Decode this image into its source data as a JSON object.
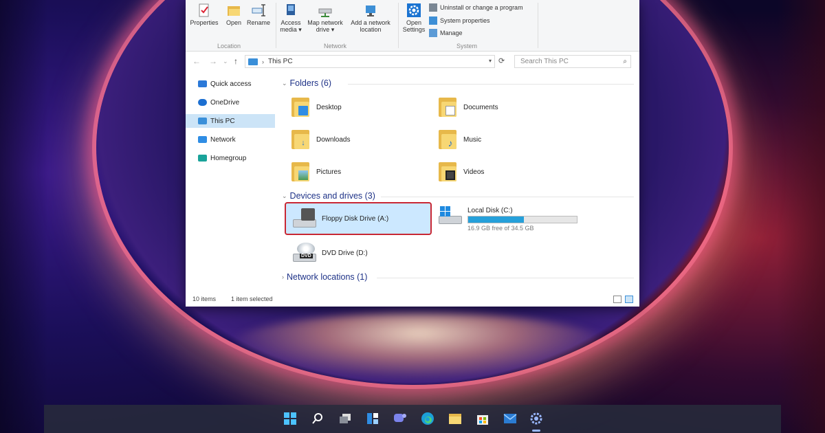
{
  "ribbon": {
    "location": {
      "label": "Location",
      "buttons": [
        "Properties",
        "Open",
        "Rename"
      ]
    },
    "network": {
      "label": "Network",
      "buttons": [
        {
          "line1": "Access",
          "line2": "media ▾"
        },
        {
          "line1": "Map network",
          "line2": "drive ▾"
        },
        {
          "line1": "Add a network",
          "line2": "location"
        }
      ]
    },
    "system": {
      "label": "System",
      "open_settings": {
        "line1": "Open",
        "line2": "Settings"
      },
      "actions": [
        "Uninstall or change a program",
        "System properties",
        "Manage"
      ]
    }
  },
  "address": {
    "path": "This PC",
    "search_placeholder": "Search This PC"
  },
  "nav_pane": {
    "items": [
      {
        "label": "Quick access",
        "icon": "star-icon",
        "color": "#2b79d8"
      },
      {
        "label": "OneDrive",
        "icon": "cloud-icon",
        "color": "#1c6fd1"
      },
      {
        "label": "This PC",
        "icon": "computer-icon",
        "color": "#3a8fd9",
        "selected": true
      },
      {
        "label": "Network",
        "icon": "network-icon",
        "color": "#2f8de4"
      },
      {
        "label": "Homegroup",
        "icon": "homegroup-icon",
        "color": "#1aa39a"
      }
    ]
  },
  "folders": {
    "heading": "Folders (6)",
    "items": [
      {
        "label": "Desktop",
        "badge": "desktop-icon"
      },
      {
        "label": "Documents",
        "badge": "document-icon"
      },
      {
        "label": "Downloads",
        "badge": "download-arrow-icon"
      },
      {
        "label": "Music",
        "badge": "music-note-icon"
      },
      {
        "label": "Pictures",
        "badge": "picture-icon"
      },
      {
        "label": "Videos",
        "badge": "film-icon"
      }
    ]
  },
  "devices": {
    "heading": "Devices and drives (3)",
    "floppy": {
      "label": "Floppy Disk Drive (A:)",
      "selected": true,
      "highlight_color": "#c82733"
    },
    "local_disk": {
      "label": "Local Disk (C:)",
      "free_text": "16.9 GB free of 34.5 GB",
      "used_fraction": 0.51
    },
    "dvd": {
      "label": "DVD Drive (D:)",
      "badge": "DVD"
    }
  },
  "network_locations": {
    "heading": "Network locations (1)"
  },
  "status": {
    "item_count": "10 items",
    "selection": "1 item selected"
  },
  "taskbar": {
    "icons": [
      "windows-start-icon",
      "search-icon",
      "task-view-icon",
      "widgets-icon",
      "teams-chat-icon",
      "edge-browser-icon",
      "file-explorer-icon",
      "store-icon",
      "mail-icon",
      "settings-gear-icon"
    ],
    "active": "settings-gear-icon"
  }
}
